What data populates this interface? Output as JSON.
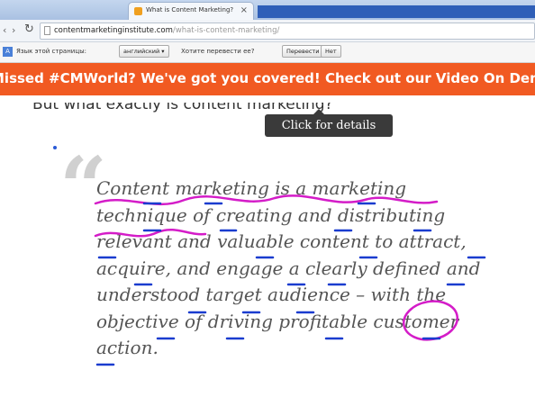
{
  "browser": {
    "tab_title": "What is Content Marketing?",
    "tab_close": "×",
    "url_domain": "contentmarketinginstitute.com",
    "url_path": "/what-is-content-marketing/",
    "reload_icon": "↻",
    "nav_back": "‹",
    "nav_forward": "›"
  },
  "translate_bar": {
    "prompt": "Язык этой страницы:",
    "language_select": "английский ▾",
    "question": "Хотите перевести ее?",
    "translate_button": "Перевести",
    "no_button": "Нет"
  },
  "banner": {
    "text": "Missed #CMWorld? We've got you covered! Check out our Video On Demand"
  },
  "page": {
    "partial_heading": "But what exactly is content marketing?",
    "tooltip": "Click for details",
    "quote_mark": "“",
    "quote_lines": [
      "Content marketing is a marketing",
      "technique of creating and distributing",
      "relevant and valuable content to attract,",
      "acquire, and engage a clearly defined and",
      "understood target audience – with the",
      "objective of driving profitable customer",
      "action."
    ]
  },
  "colors": {
    "banner": "#f15a22",
    "tooltip": "#3a3a3a",
    "quote_text": "#555555",
    "annotation_magenta": "#d41cc8",
    "annotation_blue": "#1a3ccf"
  }
}
